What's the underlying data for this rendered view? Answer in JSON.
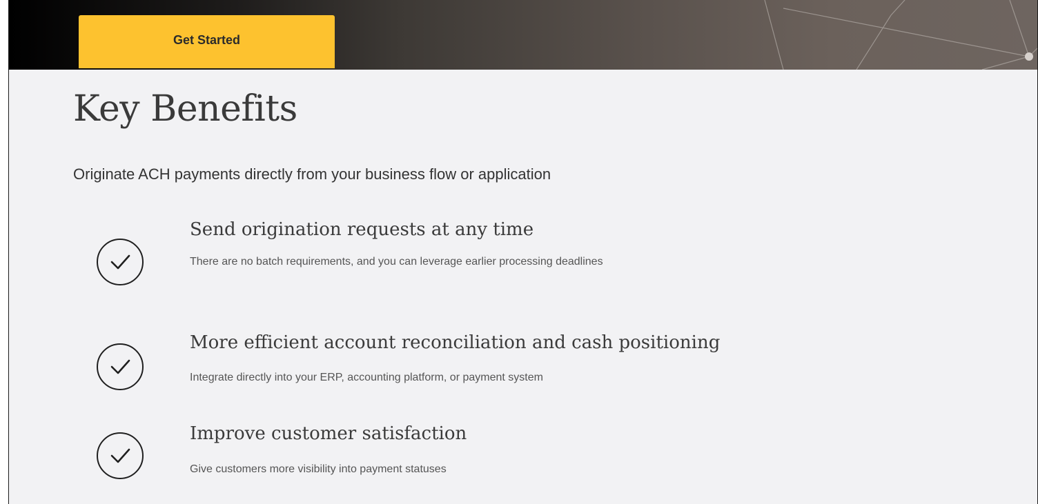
{
  "hero": {
    "cta_label": "Get Started"
  },
  "page": {
    "title": "Key Benefits",
    "intro": "Originate ACH payments directly from your business flow or application"
  },
  "benefits": [
    {
      "icon": "check-circle-icon",
      "title": "Send origination requests at any time",
      "description": "There are no batch requirements, and you can leverage earlier processing deadlines"
    },
    {
      "icon": "check-circle-icon",
      "title": "More efficient account reconciliation and cash positioning",
      "description": "Integrate directly into your ERP, accounting platform, or payment system"
    },
    {
      "icon": "check-circle-icon",
      "title": "Improve customer satisfaction",
      "description": "Give customers more visibility into payment statuses"
    }
  ],
  "colors": {
    "accent": "#fdc22f",
    "background": "#f2f2f4",
    "text": "#3a3a3a"
  }
}
